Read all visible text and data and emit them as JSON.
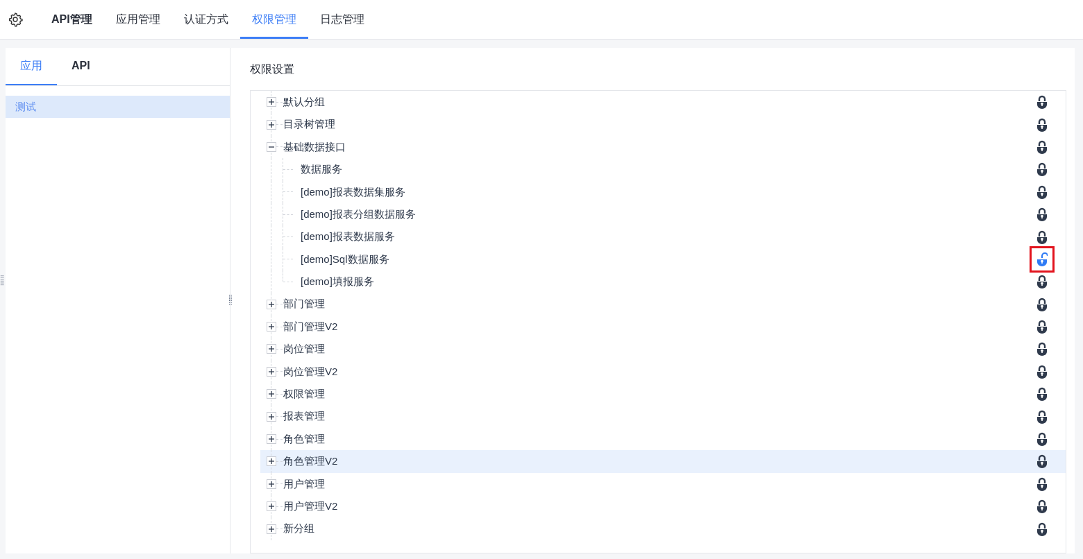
{
  "nav_tabs": [
    {
      "label": "API管理",
      "selected": false
    },
    {
      "label": "应用管理",
      "selected": false
    },
    {
      "label": "认证方式",
      "selected": false
    },
    {
      "label": "权限管理",
      "selected": true
    },
    {
      "label": "日志管理",
      "selected": false
    }
  ],
  "sidebar": {
    "tabs": [
      {
        "label": "应用",
        "selected": true
      },
      {
        "label": "API",
        "selected": false
      }
    ],
    "items": [
      {
        "label": "测试",
        "selected": true
      }
    ]
  },
  "panel": {
    "title": "权限设置",
    "tree": [
      {
        "label": "默认分组",
        "expanded": false,
        "locked": true,
        "selected": false,
        "highlighted": false
      },
      {
        "label": "目录树管理",
        "expanded": false,
        "locked": true,
        "selected": false,
        "highlighted": false
      },
      {
        "label": "基础数据接口",
        "expanded": true,
        "locked": true,
        "selected": false,
        "highlighted": false,
        "children": [
          {
            "label": "数据服务",
            "locked": true,
            "selected": false,
            "highlighted": false
          },
          {
            "label": "[demo]报表数据集服务",
            "locked": true,
            "selected": false,
            "highlighted": false
          },
          {
            "label": "[demo]报表分组数据服务",
            "locked": true,
            "selected": false,
            "highlighted": false
          },
          {
            "label": "[demo]报表数据服务",
            "locked": true,
            "selected": false,
            "highlighted": false
          },
          {
            "label": "[demo]Sql数据服务",
            "locked": false,
            "selected": false,
            "highlighted": true
          },
          {
            "label": "[demo]填报服务",
            "locked": true,
            "selected": false,
            "highlighted": false
          }
        ]
      },
      {
        "label": "部门管理",
        "expanded": false,
        "locked": true,
        "selected": false,
        "highlighted": false
      },
      {
        "label": "部门管理V2",
        "expanded": false,
        "locked": true,
        "selected": false,
        "highlighted": false
      },
      {
        "label": "岗位管理",
        "expanded": false,
        "locked": true,
        "selected": false,
        "highlighted": false
      },
      {
        "label": "岗位管理V2",
        "expanded": false,
        "locked": true,
        "selected": false,
        "highlighted": false
      },
      {
        "label": "权限管理",
        "expanded": false,
        "locked": true,
        "selected": false,
        "highlighted": false
      },
      {
        "label": "报表管理",
        "expanded": false,
        "locked": true,
        "selected": false,
        "highlighted": false
      },
      {
        "label": "角色管理",
        "expanded": false,
        "locked": true,
        "selected": false,
        "highlighted": false
      },
      {
        "label": "角色管理V2",
        "expanded": false,
        "locked": true,
        "selected": true,
        "highlighted": false
      },
      {
        "label": "用户管理",
        "expanded": false,
        "locked": true,
        "selected": false,
        "highlighted": false
      },
      {
        "label": "用户管理V2",
        "expanded": false,
        "locked": true,
        "selected": false,
        "highlighted": false
      },
      {
        "label": "新分组",
        "expanded": false,
        "locked": true,
        "selected": false,
        "highlighted": false
      }
    ]
  }
}
